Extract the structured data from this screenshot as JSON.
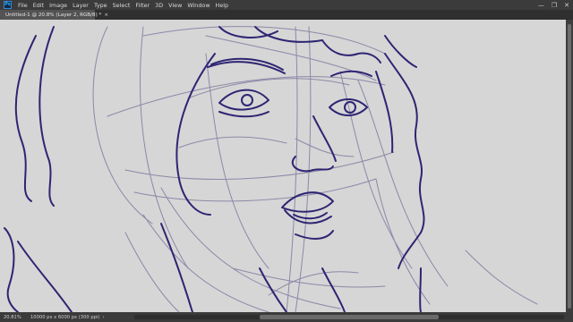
{
  "app": {
    "logo_text": "Ps",
    "accent": "#31a8ff"
  },
  "menubar": {
    "items": [
      {
        "label": "File"
      },
      {
        "label": "Edit"
      },
      {
        "label": "Image"
      },
      {
        "label": "Layer"
      },
      {
        "label": "Type"
      },
      {
        "label": "Select"
      },
      {
        "label": "Filter"
      },
      {
        "label": "3D"
      },
      {
        "label": "View"
      },
      {
        "label": "Window"
      },
      {
        "label": "Help"
      }
    ],
    "window_controls": {
      "minimize": "—",
      "restore": "❐",
      "close": "✕"
    }
  },
  "document_tab": {
    "title": "Untitled-1 @ 20.8% (Layer 2, RGB/8) *",
    "close": "×"
  },
  "canvas": {
    "background": "#d6d6d6",
    "ink_color": "#2e2573",
    "sketch_color": "#8c88a8"
  },
  "statusbar": {
    "zoom": "20.81%",
    "doc_info": "10000 px x 6000 px (300 ppi)",
    "arrow": "›"
  }
}
